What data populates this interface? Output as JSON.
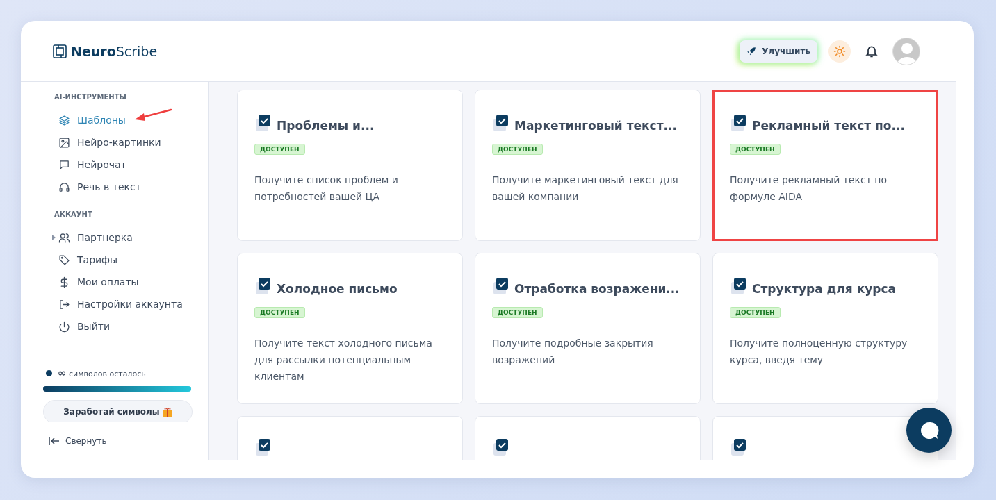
{
  "logo": {
    "bold": "Neuro",
    "light": "Scribe"
  },
  "header": {
    "upgrade_button": "Улучшить"
  },
  "sidebar": {
    "sections": [
      {
        "title": "AI-ИНСТРУМЕНТЫ",
        "items": [
          {
            "label": "Шаблоны",
            "selected": true,
            "expandable": false,
            "annotated": true
          },
          {
            "label": "Нейро-картинки",
            "selected": false,
            "expandable": false,
            "annotated": false
          },
          {
            "label": "Нейрочат",
            "selected": false,
            "expandable": false,
            "annotated": false
          },
          {
            "label": "Речь в текст",
            "selected": false,
            "expandable": false,
            "annotated": false
          }
        ]
      },
      {
        "title": "АККАУНТ",
        "items": [
          {
            "label": "Партнерка",
            "selected": false,
            "expandable": true,
            "annotated": false
          },
          {
            "label": "Тарифы",
            "selected": false,
            "expandable": false,
            "annotated": false
          },
          {
            "label": "Мои оплаты",
            "selected": false,
            "expandable": false,
            "annotated": false
          },
          {
            "label": "Настройки аккаунта",
            "selected": false,
            "expandable": false,
            "annotated": false
          },
          {
            "label": "Выйти",
            "selected": false,
            "expandable": false,
            "annotated": false
          }
        ]
      }
    ],
    "credits": {
      "amount": "∞",
      "label": "символов осталось",
      "level": 1
    },
    "earn_button": "Заработай символы",
    "collapse": "Свернуть"
  },
  "cards": [
    {
      "title": "Проблемы и...",
      "badge": "ДОСТУПЕН",
      "description": "Получите список проблем и потребностей вашей ЦА",
      "highlighted": false
    },
    {
      "title": "Маркетинговый текст...",
      "badge": "ДОСТУПЕН",
      "description": "Получите маркетинговый текст для вашей компании",
      "highlighted": false
    },
    {
      "title": "Рекламный текст по...",
      "badge": "ДОСТУПЕН",
      "description": "Получите рекламный текст по формуле AIDA",
      "highlighted": true
    },
    {
      "title": "Холодное письмо",
      "badge": "ДОСТУПЕН",
      "description": "Получите текст холодного письма для рассылки потенциальным клиентам",
      "highlighted": false
    },
    {
      "title": "Отработка возражени...",
      "badge": "ДОСТУПЕН",
      "description": "Получите подробные закрытия возражений",
      "highlighted": false
    },
    {
      "title": "Структура для курса",
      "badge": "ДОСТУПЕН",
      "description": "Получите полноценную структуру курса, введя тему",
      "highlighted": false
    }
  ]
}
